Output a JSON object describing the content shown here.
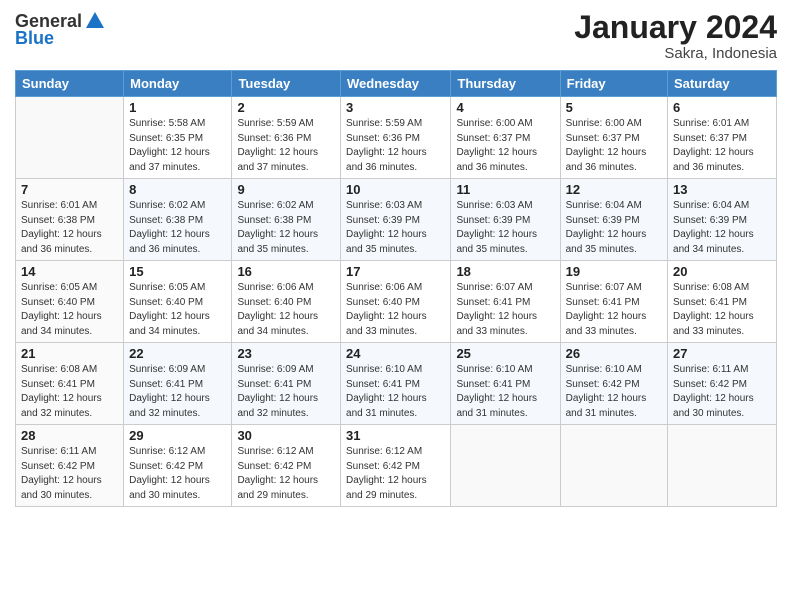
{
  "header": {
    "logo_line1": "General",
    "logo_line2": "Blue",
    "month_year": "January 2024",
    "location": "Sakra, Indonesia"
  },
  "weekdays": [
    "Sunday",
    "Monday",
    "Tuesday",
    "Wednesday",
    "Thursday",
    "Friday",
    "Saturday"
  ],
  "weeks": [
    [
      {
        "day": "",
        "sunrise": "",
        "sunset": "",
        "daylight": ""
      },
      {
        "day": "1",
        "sunrise": "Sunrise: 5:58 AM",
        "sunset": "Sunset: 6:35 PM",
        "daylight": "Daylight: 12 hours and 37 minutes."
      },
      {
        "day": "2",
        "sunrise": "Sunrise: 5:59 AM",
        "sunset": "Sunset: 6:36 PM",
        "daylight": "Daylight: 12 hours and 37 minutes."
      },
      {
        "day": "3",
        "sunrise": "Sunrise: 5:59 AM",
        "sunset": "Sunset: 6:36 PM",
        "daylight": "Daylight: 12 hours and 36 minutes."
      },
      {
        "day": "4",
        "sunrise": "Sunrise: 6:00 AM",
        "sunset": "Sunset: 6:37 PM",
        "daylight": "Daylight: 12 hours and 36 minutes."
      },
      {
        "day": "5",
        "sunrise": "Sunrise: 6:00 AM",
        "sunset": "Sunset: 6:37 PM",
        "daylight": "Daylight: 12 hours and 36 minutes."
      },
      {
        "day": "6",
        "sunrise": "Sunrise: 6:01 AM",
        "sunset": "Sunset: 6:37 PM",
        "daylight": "Daylight: 12 hours and 36 minutes."
      }
    ],
    [
      {
        "day": "7",
        "sunrise": "Sunrise: 6:01 AM",
        "sunset": "Sunset: 6:38 PM",
        "daylight": "Daylight: 12 hours and 36 minutes."
      },
      {
        "day": "8",
        "sunrise": "Sunrise: 6:02 AM",
        "sunset": "Sunset: 6:38 PM",
        "daylight": "Daylight: 12 hours and 36 minutes."
      },
      {
        "day": "9",
        "sunrise": "Sunrise: 6:02 AM",
        "sunset": "Sunset: 6:38 PM",
        "daylight": "Daylight: 12 hours and 35 minutes."
      },
      {
        "day": "10",
        "sunrise": "Sunrise: 6:03 AM",
        "sunset": "Sunset: 6:39 PM",
        "daylight": "Daylight: 12 hours and 35 minutes."
      },
      {
        "day": "11",
        "sunrise": "Sunrise: 6:03 AM",
        "sunset": "Sunset: 6:39 PM",
        "daylight": "Daylight: 12 hours and 35 minutes."
      },
      {
        "day": "12",
        "sunrise": "Sunrise: 6:04 AM",
        "sunset": "Sunset: 6:39 PM",
        "daylight": "Daylight: 12 hours and 35 minutes."
      },
      {
        "day": "13",
        "sunrise": "Sunrise: 6:04 AM",
        "sunset": "Sunset: 6:39 PM",
        "daylight": "Daylight: 12 hours and 34 minutes."
      }
    ],
    [
      {
        "day": "14",
        "sunrise": "Sunrise: 6:05 AM",
        "sunset": "Sunset: 6:40 PM",
        "daylight": "Daylight: 12 hours and 34 minutes."
      },
      {
        "day": "15",
        "sunrise": "Sunrise: 6:05 AM",
        "sunset": "Sunset: 6:40 PM",
        "daylight": "Daylight: 12 hours and 34 minutes."
      },
      {
        "day": "16",
        "sunrise": "Sunrise: 6:06 AM",
        "sunset": "Sunset: 6:40 PM",
        "daylight": "Daylight: 12 hours and 34 minutes."
      },
      {
        "day": "17",
        "sunrise": "Sunrise: 6:06 AM",
        "sunset": "Sunset: 6:40 PM",
        "daylight": "Daylight: 12 hours and 33 minutes."
      },
      {
        "day": "18",
        "sunrise": "Sunrise: 6:07 AM",
        "sunset": "Sunset: 6:41 PM",
        "daylight": "Daylight: 12 hours and 33 minutes."
      },
      {
        "day": "19",
        "sunrise": "Sunrise: 6:07 AM",
        "sunset": "Sunset: 6:41 PM",
        "daylight": "Daylight: 12 hours and 33 minutes."
      },
      {
        "day": "20",
        "sunrise": "Sunrise: 6:08 AM",
        "sunset": "Sunset: 6:41 PM",
        "daylight": "Daylight: 12 hours and 33 minutes."
      }
    ],
    [
      {
        "day": "21",
        "sunrise": "Sunrise: 6:08 AM",
        "sunset": "Sunset: 6:41 PM",
        "daylight": "Daylight: 12 hours and 32 minutes."
      },
      {
        "day": "22",
        "sunrise": "Sunrise: 6:09 AM",
        "sunset": "Sunset: 6:41 PM",
        "daylight": "Daylight: 12 hours and 32 minutes."
      },
      {
        "day": "23",
        "sunrise": "Sunrise: 6:09 AM",
        "sunset": "Sunset: 6:41 PM",
        "daylight": "Daylight: 12 hours and 32 minutes."
      },
      {
        "day": "24",
        "sunrise": "Sunrise: 6:10 AM",
        "sunset": "Sunset: 6:41 PM",
        "daylight": "Daylight: 12 hours and 31 minutes."
      },
      {
        "day": "25",
        "sunrise": "Sunrise: 6:10 AM",
        "sunset": "Sunset: 6:41 PM",
        "daylight": "Daylight: 12 hours and 31 minutes."
      },
      {
        "day": "26",
        "sunrise": "Sunrise: 6:10 AM",
        "sunset": "Sunset: 6:42 PM",
        "daylight": "Daylight: 12 hours and 31 minutes."
      },
      {
        "day": "27",
        "sunrise": "Sunrise: 6:11 AM",
        "sunset": "Sunset: 6:42 PM",
        "daylight": "Daylight: 12 hours and 30 minutes."
      }
    ],
    [
      {
        "day": "28",
        "sunrise": "Sunrise: 6:11 AM",
        "sunset": "Sunset: 6:42 PM",
        "daylight": "Daylight: 12 hours and 30 minutes."
      },
      {
        "day": "29",
        "sunrise": "Sunrise: 6:12 AM",
        "sunset": "Sunset: 6:42 PM",
        "daylight": "Daylight: 12 hours and 30 minutes."
      },
      {
        "day": "30",
        "sunrise": "Sunrise: 6:12 AM",
        "sunset": "Sunset: 6:42 PM",
        "daylight": "Daylight: 12 hours and 29 minutes."
      },
      {
        "day": "31",
        "sunrise": "Sunrise: 6:12 AM",
        "sunset": "Sunset: 6:42 PM",
        "daylight": "Daylight: 12 hours and 29 minutes."
      },
      {
        "day": "",
        "sunrise": "",
        "sunset": "",
        "daylight": ""
      },
      {
        "day": "",
        "sunrise": "",
        "sunset": "",
        "daylight": ""
      },
      {
        "day": "",
        "sunrise": "",
        "sunset": "",
        "daylight": ""
      }
    ]
  ]
}
